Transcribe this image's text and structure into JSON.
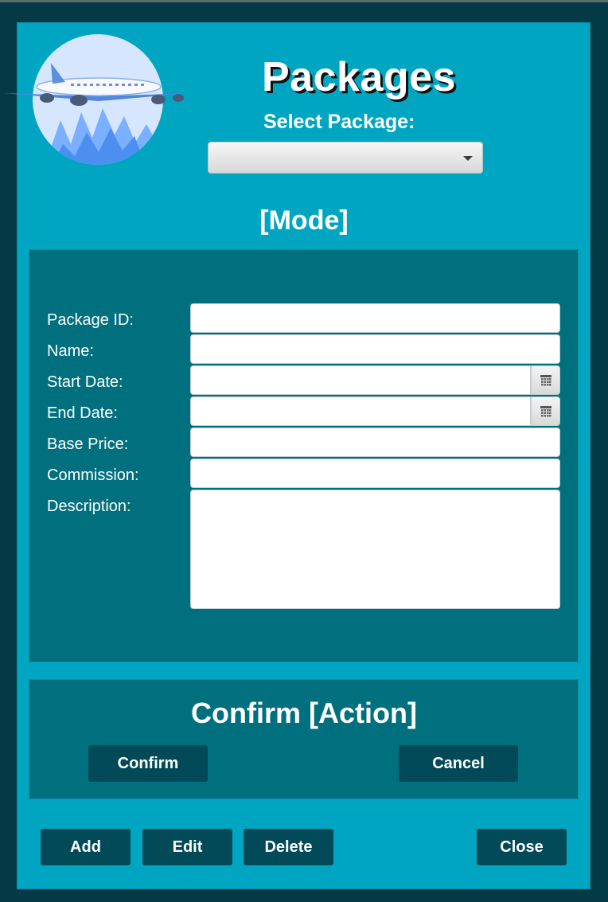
{
  "header": {
    "title": "Packages",
    "select_label": "Select Package:",
    "select_value": ""
  },
  "mode_label": "[Mode]",
  "form": {
    "fields": [
      {
        "label": "Package ID:",
        "value": ""
      },
      {
        "label": "Name:",
        "value": ""
      },
      {
        "label": "Start Date:",
        "value": ""
      },
      {
        "label": "End Date:",
        "value": ""
      },
      {
        "label": "Base Price:",
        "value": ""
      },
      {
        "label": "Commission:",
        "value": ""
      },
      {
        "label": "Description:",
        "value": ""
      }
    ]
  },
  "confirm": {
    "title": "Confirm [Action]",
    "confirm_label": "Confirm",
    "cancel_label": "Cancel"
  },
  "toolbar": {
    "add_label": "Add",
    "edit_label": "Edit",
    "delete_label": "Delete",
    "close_label": "Close"
  },
  "icons": {
    "logo": "airplane-logo-icon",
    "select_caret": "chevron-down-icon",
    "calendar": "calendar-icon"
  },
  "colors": {
    "background": "#033a45",
    "panel": "#00a6c1",
    "inner_panel": "#00707f",
    "button": "#024a58",
    "text": "#ffffff"
  }
}
